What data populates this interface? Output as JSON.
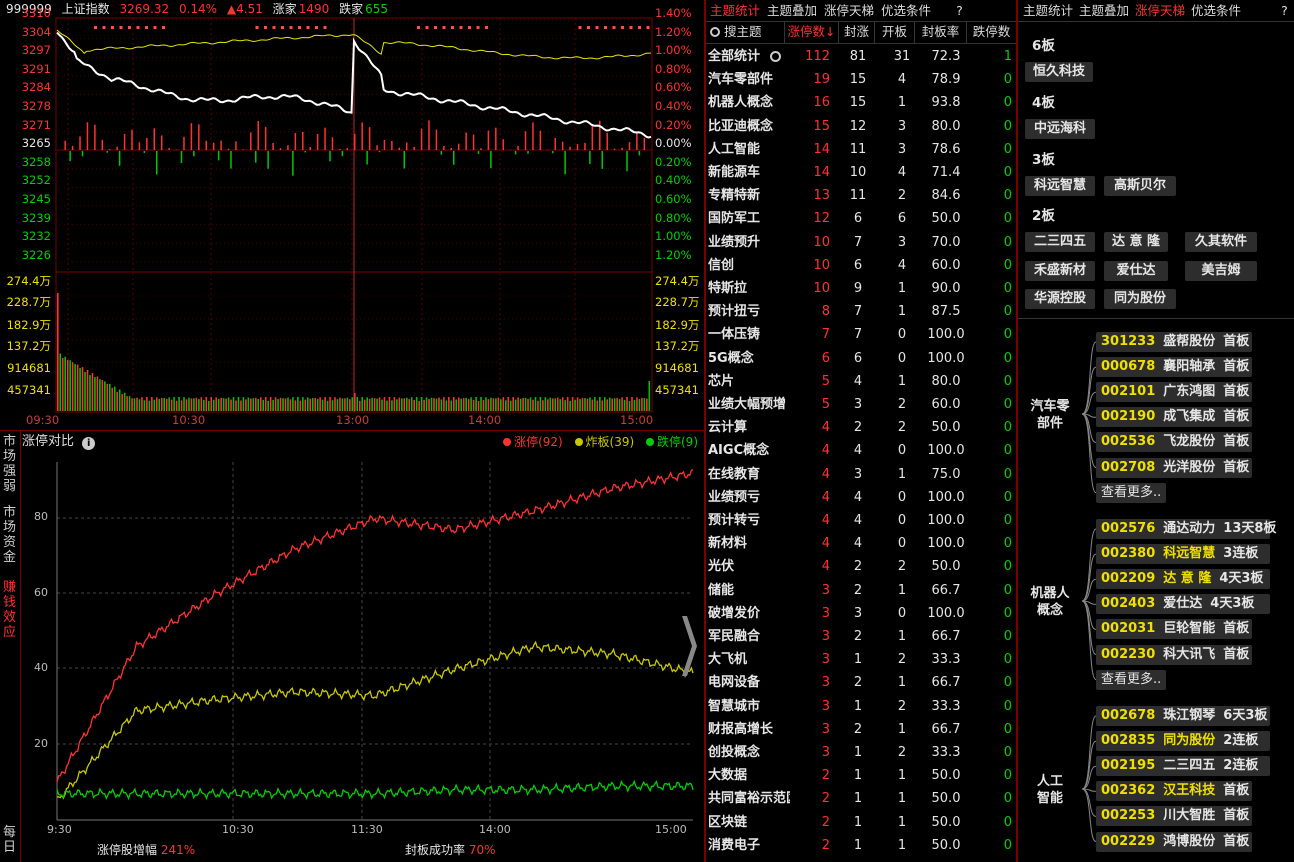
{
  "index_header": {
    "code": "999999",
    "name": "上证指数",
    "price": "3269.32",
    "pct": "0.14%",
    "change": "▲4.51",
    "up_label": "涨家",
    "up_count": "1490",
    "down_label": "跌家",
    "down_count": "655"
  },
  "price_axis_left": [
    "3310",
    "3304",
    "3297",
    "3291",
    "3284",
    "3278",
    "3271",
    "3265",
    "3258",
    "3252",
    "3245",
    "3239",
    "3232",
    "3226"
  ],
  "price_axis_right": [
    "1.40%",
    "1.20%",
    "1.00%",
    "0.80%",
    "0.60%",
    "0.40%",
    "0.20%",
    "0.00%",
    "0.20%",
    "0.40%",
    "0.60%",
    "0.80%",
    "1.00%",
    "1.20%"
  ],
  "volume_axis": [
    "274.4万",
    "228.7万",
    "182.9万",
    "137.2万",
    "914681",
    "457341"
  ],
  "time_axis": [
    "09:30",
    "10:30",
    "13:00",
    "14:00",
    "15:00"
  ],
  "lower_panel": {
    "title": "涨停对比",
    "info_icon": "info-icon",
    "legend": [
      {
        "label": "涨停(92)",
        "color": "#ff3232"
      },
      {
        "label": "炸板(39)",
        "color": "#c8c800"
      },
      {
        "label": "跌停(9)",
        "color": "#00d000"
      }
    ],
    "side_tabs": [
      "市场强弱",
      "市场资金",
      "赚钱效应",
      "每日"
    ],
    "y_labels": [
      "80",
      "60",
      "40",
      "20"
    ],
    "x_labels": [
      "9:30",
      "10:30",
      "11:30",
      "14:00",
      "15:00"
    ],
    "footer_left_label": "涨停股增幅",
    "footer_left_value": "241%",
    "footer_right_label": "封板成功率",
    "footer_right_value": "70%"
  },
  "chart_data": {
    "type": "line",
    "title": "涨停对比",
    "x": [
      "9:30",
      "10:30",
      "11:30",
      "14:00",
      "15:00"
    ],
    "ylim": [
      0,
      95
    ],
    "series": [
      {
        "name": "涨停",
        "color": "#ff3232",
        "values": [
          10,
          46,
          60,
          72,
          80,
          77,
          82,
          88,
          92
        ]
      },
      {
        "name": "炸板",
        "color": "#c8c800",
        "values": [
          5,
          29,
          32,
          34,
          33,
          40,
          46,
          44,
          39
        ]
      },
      {
        "name": "跌停",
        "color": "#00d000",
        "values": [
          7,
          7,
          7,
          7,
          7,
          8,
          8,
          9,
          9
        ]
      }
    ]
  },
  "mid_tabs": [
    "主题统计",
    "主题叠加",
    "涨停天梯",
    "优选条件",
    "?"
  ],
  "mid_headers": [
    "搜主题",
    "涨停数↓",
    "封涨",
    "开板",
    "封板率",
    "跌停数"
  ],
  "mid_rows": [
    [
      "全部统计",
      "112",
      "81",
      "31",
      "72.3",
      "1"
    ],
    [
      "汽车零部件",
      "19",
      "15",
      "4",
      "78.9",
      "0"
    ],
    [
      "机器人概念",
      "16",
      "15",
      "1",
      "93.8",
      "0"
    ],
    [
      "比亚迪概念",
      "15",
      "12",
      "3",
      "80.0",
      "0"
    ],
    [
      "人工智能",
      "14",
      "11",
      "3",
      "78.6",
      "0"
    ],
    [
      "新能源车",
      "14",
      "10",
      "4",
      "71.4",
      "0"
    ],
    [
      "专精特新",
      "13",
      "11",
      "2",
      "84.6",
      "0"
    ],
    [
      "国防军工",
      "12",
      "6",
      "6",
      "50.0",
      "0"
    ],
    [
      "业绩预升",
      "10",
      "7",
      "3",
      "70.0",
      "0"
    ],
    [
      "信创",
      "10",
      "6",
      "4",
      "60.0",
      "0"
    ],
    [
      "特斯拉",
      "10",
      "9",
      "1",
      "90.0",
      "0"
    ],
    [
      "预计扭亏",
      "8",
      "7",
      "1",
      "87.5",
      "0"
    ],
    [
      "一体压铸",
      "7",
      "7",
      "0",
      "100.0",
      "0"
    ],
    [
      "5G概念",
      "6",
      "6",
      "0",
      "100.0",
      "0"
    ],
    [
      "芯片",
      "5",
      "4",
      "1",
      "80.0",
      "0"
    ],
    [
      "业绩大幅预增",
      "5",
      "3",
      "2",
      "60.0",
      "0"
    ],
    [
      "云计算",
      "4",
      "2",
      "2",
      "50.0",
      "0"
    ],
    [
      "AIGC概念",
      "4",
      "4",
      "0",
      "100.0",
      "0"
    ],
    [
      "在线教育",
      "4",
      "3",
      "1",
      "75.0",
      "0"
    ],
    [
      "业绩预亏",
      "4",
      "4",
      "0",
      "100.0",
      "0"
    ],
    [
      "预计转亏",
      "4",
      "4",
      "0",
      "100.0",
      "0"
    ],
    [
      "新材料",
      "4",
      "4",
      "0",
      "100.0",
      "0"
    ],
    [
      "光伏",
      "4",
      "2",
      "2",
      "50.0",
      "0"
    ],
    [
      "储能",
      "3",
      "2",
      "1",
      "66.7",
      "0"
    ],
    [
      "破增发价",
      "3",
      "3",
      "0",
      "100.0",
      "0"
    ],
    [
      "军民融合",
      "3",
      "2",
      "1",
      "66.7",
      "0"
    ],
    [
      "大飞机",
      "3",
      "1",
      "2",
      "33.3",
      "0"
    ],
    [
      "电网设备",
      "3",
      "2",
      "1",
      "66.7",
      "0"
    ],
    [
      "智慧城市",
      "3",
      "1",
      "2",
      "33.3",
      "0"
    ],
    [
      "财报高增长",
      "3",
      "2",
      "1",
      "66.7",
      "0"
    ],
    [
      "创投概念",
      "3",
      "1",
      "2",
      "33.3",
      "0"
    ],
    [
      "大数据",
      "2",
      "1",
      "1",
      "50.0",
      "0"
    ],
    [
      "共同富裕示范区",
      "2",
      "1",
      "1",
      "50.0",
      "0"
    ],
    [
      "区块链",
      "2",
      "1",
      "1",
      "50.0",
      "0"
    ],
    [
      "消费电子",
      "2",
      "1",
      "1",
      "50.0",
      "0"
    ]
  ],
  "right_tabs": [
    "主题统计",
    "主题叠加",
    "涨停天梯",
    "优选条件",
    "?"
  ],
  "ladder": [
    {
      "label": "6板",
      "stocks": [
        "恒久科技"
      ]
    },
    {
      "label": "4板",
      "stocks": [
        "中远海科"
      ]
    },
    {
      "label": "3板",
      "stocks": [
        "科远智慧",
        "高斯贝尔"
      ]
    },
    {
      "label": "2板",
      "stocks": [
        "二三四五",
        "达 意 隆",
        "久其软件",
        "禾盛新材",
        "爱仕达",
        "美吉姆",
        "华源控股",
        "同为股份"
      ]
    }
  ],
  "groups": [
    {
      "name": "汽车零部件",
      "stocks": [
        [
          "301233",
          "盛帮股份",
          "首板"
        ],
        [
          "000678",
          "襄阳轴承",
          "首板"
        ],
        [
          "002101",
          "广东鸿图",
          "首板"
        ],
        [
          "002190",
          "成飞集成",
          "首板"
        ],
        [
          "002536",
          "飞龙股份",
          "首板"
        ],
        [
          "002708",
          "光洋股份",
          "首板"
        ]
      ],
      "more": "查看更多.."
    },
    {
      "name": "机器人概念",
      "stocks": [
        [
          "002576",
          "通达动力",
          "13天8板"
        ],
        [
          "002380",
          "科远智慧",
          "3连板"
        ],
        [
          "002209",
          "达 意 隆",
          "4天3板"
        ],
        [
          "002403",
          "爱仕达",
          "4天3板"
        ],
        [
          "002031",
          "巨轮智能",
          "首板"
        ],
        [
          "002230",
          "科大讯飞",
          "首板"
        ]
      ],
      "more": "查看更多.."
    },
    {
      "name": "人工智能",
      "stocks": [
        [
          "002678",
          "珠江钢琴",
          "6天3板"
        ],
        [
          "002835",
          "同为股份",
          "2连板"
        ],
        [
          "002195",
          "二三四五",
          "2连板"
        ],
        [
          "002362",
          "汉王科技",
          "首板"
        ],
        [
          "002253",
          "川大智胜",
          "首板"
        ],
        [
          "002229",
          "鸿博股份",
          "首板"
        ]
      ]
    }
  ]
}
